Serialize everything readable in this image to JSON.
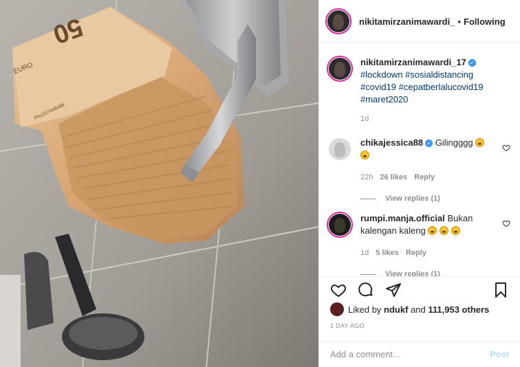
{
  "header": {
    "username": "nikitamirzanimawardi_",
    "separator": "•",
    "follow_label": "Following"
  },
  "caption": {
    "username": "nikitamirzanimawardi_17",
    "verified_glyph": "✓",
    "hashtags": "#lockdown #sosialdistancing #covid19 #cepatberlalucovid19 #maret2020",
    "age": "1d"
  },
  "comments": [
    {
      "username": "chikajessica88",
      "text": "Gilingggg",
      "age": "22h",
      "likes": "26 likes",
      "reply_label": "Reply",
      "view_replies": "View replies (1)"
    },
    {
      "username": "rumpi.manja.official",
      "text": "Bukan kalengan kaleng",
      "age": "1d",
      "likes": "5 likes",
      "reply_label": "Reply",
      "view_replies": "View replies (1)"
    }
  ],
  "banknote_text": {
    "value": "50",
    "currency": "EURO",
    "serial": "PA1237448498"
  },
  "likes": {
    "prefix": "Liked by",
    "user": "ndukf",
    "mid": "and",
    "count": "111,953 others"
  },
  "date_label": "1 DAY AGO",
  "add_comment": {
    "placeholder": "Add a comment...",
    "post_label": "Post"
  },
  "icons": {
    "like": "heart-icon",
    "comment": "comment-icon",
    "share": "share-icon",
    "save": "bookmark-icon"
  },
  "colors": {
    "link": "#00376b",
    "verified": "#3897f0",
    "muted": "#8e8e8e",
    "post_disabled": "#b2dffc"
  }
}
